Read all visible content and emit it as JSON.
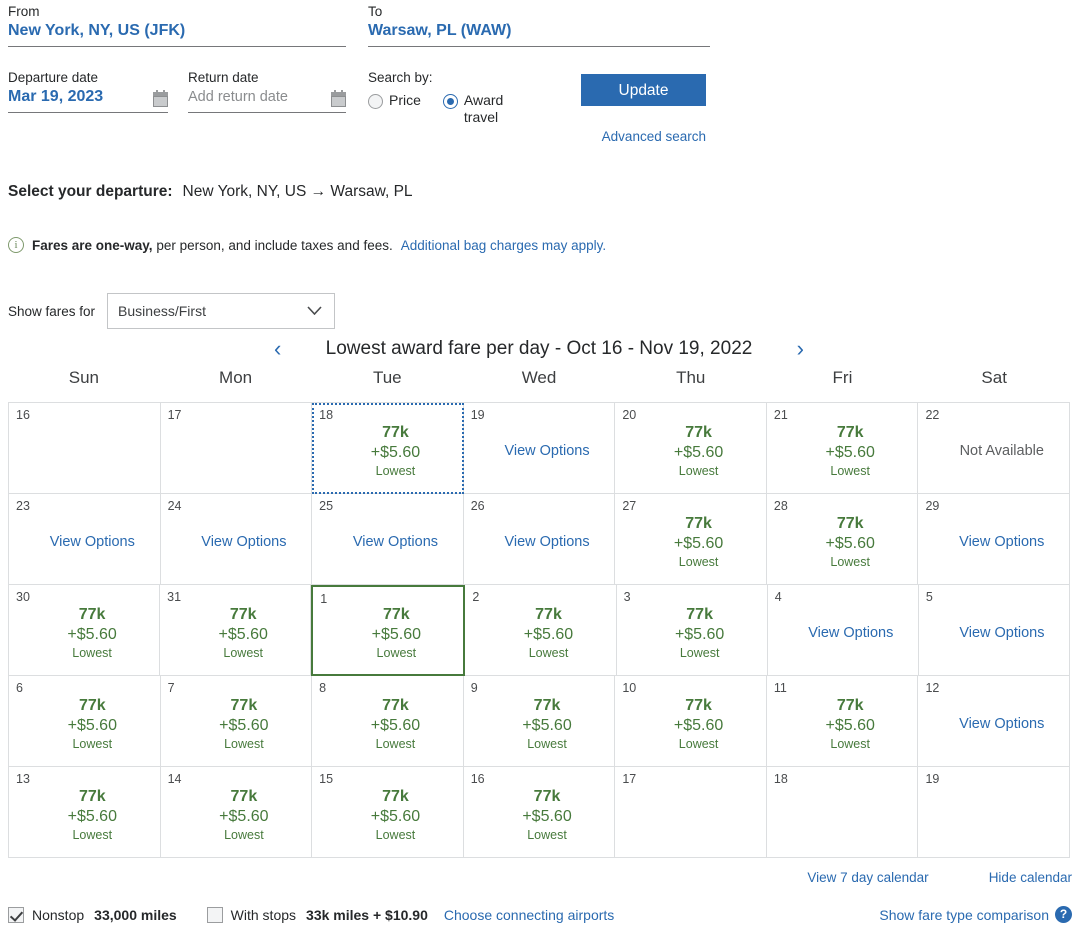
{
  "search": {
    "from_label": "From",
    "from_value": "New York, NY, US (JFK)",
    "to_label": "To",
    "to_value": "Warsaw, PL (WAW)",
    "departure_label": "Departure date",
    "departure_value": "Mar 19, 2023",
    "return_label": "Return date",
    "return_placeholder": "Add return date",
    "searchby_label": "Search by:",
    "radio_price": "Price",
    "radio_award": "Award travel",
    "selected_search_by": "Award travel",
    "update_label": "Update",
    "advanced_search_label": "Advanced search",
    "accent_blue": "#2a6ab0"
  },
  "departure": {
    "heading": "Select your departure:",
    "route": "New York, NY, US → Warsaw, PL"
  },
  "info": {
    "icon": "info-icon",
    "bold_text": "Fares are one-way,",
    "text": " per person, and include taxes and fees.",
    "link_text": "Additional bag charges may apply."
  },
  "fares_filter": {
    "label": "Show fares for",
    "selected": "Business/First",
    "options": [
      "Business/First"
    ]
  },
  "calendar": {
    "prev_label": "‹",
    "next_label": "›",
    "title": "Lowest award fare per day - Oct 16 - Nov 19, 2022",
    "weekdays": [
      "Sun",
      "Mon",
      "Tue",
      "Wed",
      "Thu",
      "Fri",
      "Sat"
    ],
    "fare_green": "#477a3c",
    "view_options_label": "View Options",
    "not_available_label": "Not Available",
    "lowest_label": "Lowest",
    "weeks": [
      [
        {
          "day": "16",
          "type": "empty"
        },
        {
          "day": "17",
          "type": "empty"
        },
        {
          "day": "18",
          "type": "fare",
          "miles": "77k",
          "tax": "+$5.60",
          "note": "Lowest",
          "state": "focused"
        },
        {
          "day": "19",
          "type": "link",
          "label": "View Options"
        },
        {
          "day": "20",
          "type": "fare",
          "miles": "77k",
          "tax": "+$5.60",
          "note": "Lowest"
        },
        {
          "day": "21",
          "type": "fare",
          "miles": "77k",
          "tax": "+$5.60",
          "note": "Lowest"
        },
        {
          "day": "22",
          "type": "unavailable",
          "label": "Not Available"
        }
      ],
      [
        {
          "day": "23",
          "type": "link",
          "label": "View Options"
        },
        {
          "day": "24",
          "type": "link",
          "label": "View Options"
        },
        {
          "day": "25",
          "type": "link",
          "label": "View Options"
        },
        {
          "day": "26",
          "type": "link",
          "label": "View Options"
        },
        {
          "day": "27",
          "type": "fare",
          "miles": "77k",
          "tax": "+$5.60",
          "note": "Lowest"
        },
        {
          "day": "28",
          "type": "fare",
          "miles": "77k",
          "tax": "+$5.60",
          "note": "Lowest"
        },
        {
          "day": "29",
          "type": "link",
          "label": "View Options"
        }
      ],
      [
        {
          "day": "30",
          "type": "fare",
          "miles": "77k",
          "tax": "+$5.60",
          "note": "Lowest"
        },
        {
          "day": "31",
          "type": "fare",
          "miles": "77k",
          "tax": "+$5.60",
          "note": "Lowest"
        },
        {
          "day": "1",
          "type": "fare",
          "miles": "77k",
          "tax": "+$5.60",
          "note": "Lowest",
          "state": "selected"
        },
        {
          "day": "2",
          "type": "fare",
          "miles": "77k",
          "tax": "+$5.60",
          "note": "Lowest"
        },
        {
          "day": "3",
          "type": "fare",
          "miles": "77k",
          "tax": "+$5.60",
          "note": "Lowest"
        },
        {
          "day": "4",
          "type": "link",
          "label": "View Options"
        },
        {
          "day": "5",
          "type": "link",
          "label": "View Options"
        }
      ],
      [
        {
          "day": "6",
          "type": "fare",
          "miles": "77k",
          "tax": "+$5.60",
          "note": "Lowest"
        },
        {
          "day": "7",
          "type": "fare",
          "miles": "77k",
          "tax": "+$5.60",
          "note": "Lowest"
        },
        {
          "day": "8",
          "type": "fare",
          "miles": "77k",
          "tax": "+$5.60",
          "note": "Lowest"
        },
        {
          "day": "9",
          "type": "fare",
          "miles": "77k",
          "tax": "+$5.60",
          "note": "Lowest"
        },
        {
          "day": "10",
          "type": "fare",
          "miles": "77k",
          "tax": "+$5.60",
          "note": "Lowest"
        },
        {
          "day": "11",
          "type": "fare",
          "miles": "77k",
          "tax": "+$5.60",
          "note": "Lowest"
        },
        {
          "day": "12",
          "type": "link",
          "label": "View Options"
        }
      ],
      [
        {
          "day": "13",
          "type": "fare",
          "miles": "77k",
          "tax": "+$5.60",
          "note": "Lowest"
        },
        {
          "day": "14",
          "type": "fare",
          "miles": "77k",
          "tax": "+$5.60",
          "note": "Lowest"
        },
        {
          "day": "15",
          "type": "fare",
          "miles": "77k",
          "tax": "+$5.60",
          "note": "Lowest"
        },
        {
          "day": "16",
          "type": "fare",
          "miles": "77k",
          "tax": "+$5.60",
          "note": "Lowest"
        },
        {
          "day": "17",
          "type": "empty"
        },
        {
          "day": "18",
          "type": "empty"
        },
        {
          "day": "19",
          "type": "empty"
        }
      ]
    ]
  },
  "calendar_footer": {
    "view_7_day": "View 7 day calendar",
    "hide_calendar": "Hide calendar"
  },
  "bottom": {
    "nonstop_label": "Nonstop",
    "nonstop_value": "33,000 miles",
    "nonstop_checked": true,
    "withstops_label": "With stops",
    "withstops_value": "33k miles + $10.90",
    "withstops_checked": false,
    "choose_airports_label": "Choose connecting airports",
    "fare_comparison_label": "Show fare type comparison",
    "help_icon": "question-mark-icon"
  }
}
